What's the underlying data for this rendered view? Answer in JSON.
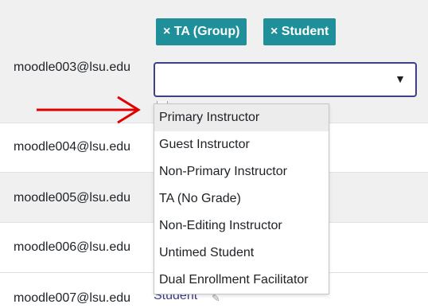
{
  "rows": [
    {
      "email": "moodle003@lsu.edu"
    },
    {
      "email": "moodle004@lsu.edu"
    },
    {
      "email": "moodle005@lsu.edu"
    },
    {
      "email": "moodle006@lsu.edu"
    },
    {
      "email": "moodle007@lsu.edu",
      "role": "Student"
    }
  ],
  "tags": [
    {
      "label": "× TA (Group)"
    },
    {
      "label": "× Student"
    }
  ],
  "select": {
    "value": "",
    "caret": "▼"
  },
  "dropdown": {
    "options": [
      "Primary Instructor",
      "Guest Instructor",
      "Non-Primary Instructor",
      "TA (No Grade)",
      "Non-Editing Instructor",
      "Untimed Student",
      "Dual Enrollment Facilitator"
    ],
    "highlighted_index": 0
  },
  "colors": {
    "tag_bg": "#1f8f99",
    "select_border": "#3d3f88",
    "arrow": "#e10000",
    "row_shade": "#f0f0f0"
  }
}
